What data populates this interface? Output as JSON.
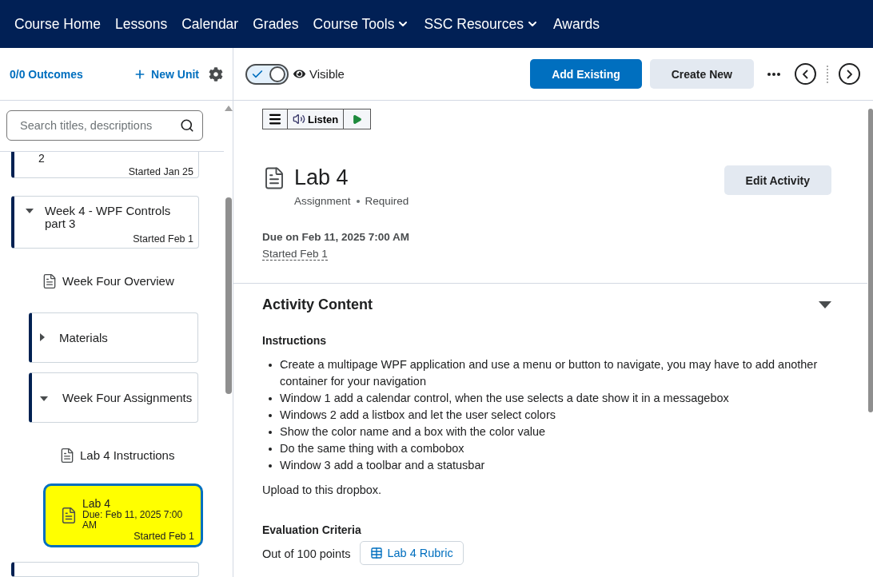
{
  "nav": {
    "items": [
      {
        "label": "Course Home",
        "has_menu": false
      },
      {
        "label": "Lessons",
        "has_menu": false
      },
      {
        "label": "Calendar",
        "has_menu": false
      },
      {
        "label": "Grades",
        "has_menu": false
      },
      {
        "label": "Course Tools",
        "has_menu": true
      },
      {
        "label": "SSC Resources",
        "has_menu": true
      },
      {
        "label": "Awards",
        "has_menu": false
      }
    ]
  },
  "sidebar": {
    "outcomes": "0/0 Outcomes",
    "new_unit": "New Unit",
    "search": {
      "placeholder": "Search titles, descriptions"
    },
    "cut_unit": {
      "title": "2",
      "started": "Started Jan 25"
    },
    "units": [
      {
        "title": "Week 4 - WPF Controls part 3",
        "started": "Started Feb 1",
        "expanded": true,
        "children": [
          {
            "kind": "topic",
            "title": "Week Four Overview",
            "selected": false
          },
          {
            "kind": "module",
            "title": "Materials",
            "expanded": false
          },
          {
            "kind": "module",
            "title": "Week Four Assignments",
            "expanded": true,
            "children": [
              {
                "kind": "topic",
                "title": "Lab 4 Instructions",
                "selected": false
              },
              {
                "kind": "assignment",
                "title": "Lab 4",
                "due": "Due: Feb 11, 2025 7:00 AM",
                "started": "Started Feb 1",
                "selected": true
              }
            ]
          }
        ]
      }
    ]
  },
  "toolbar": {
    "visible_toggle": {
      "on": true
    },
    "visibility": "Visible",
    "add_existing": "Add Existing",
    "create_new": "Create New"
  },
  "reader": {
    "listen": "Listen"
  },
  "activity": {
    "title": "Lab 4",
    "type": "Assignment",
    "status": "Required",
    "due": "Due on Feb 11, 2025 7:00 AM",
    "started": "Started Feb 1",
    "edit": "Edit Activity"
  },
  "content": {
    "heading": "Activity Content",
    "expanded": true,
    "instructions_heading": "Instructions",
    "bullets": [
      "Create a multipage WPF application and use a menu or button to navigate, you may have to add another container for your navigation",
      "Window 1 add a calendar control, when the use selects a date show it in a messagebox",
      "Windows 2 add a listbox and let the user select colors",
      "Show the color name and a box with the color value",
      "Do the same thing with a combobox",
      "Window 3 add a toolbar and a statusbar"
    ],
    "note": "Upload to this dropbox.",
    "evaluation_heading": "Evaluation Criteria",
    "points": "Out of 100 points",
    "rubric": "Lab 4 Rubric"
  }
}
